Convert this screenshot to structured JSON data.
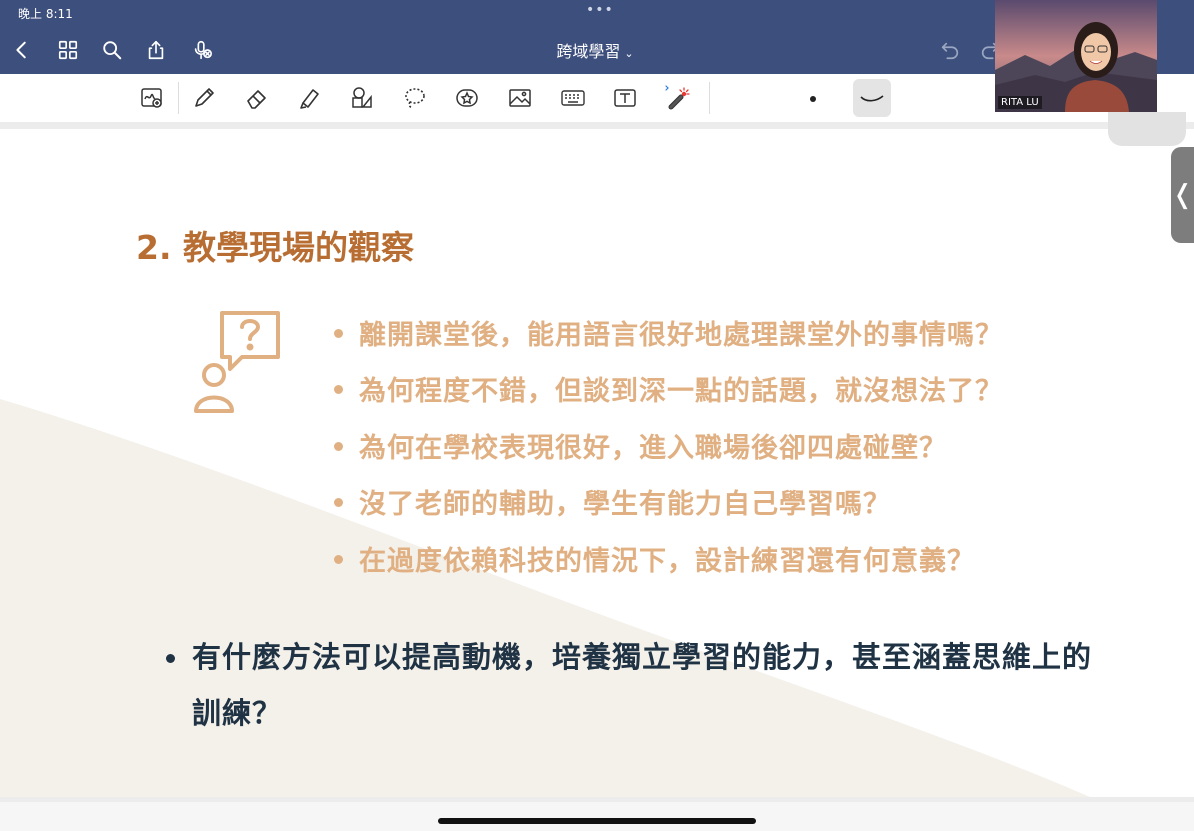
{
  "status_bar": {
    "time": "晚上 8:11",
    "dots": "•••"
  },
  "nav": {
    "title": "跨域學習",
    "title_chevron": "⌄",
    "icons": [
      "back-icon",
      "grid-icon",
      "search-icon",
      "share-icon",
      "mic-off-icon",
      "undo-icon",
      "redo-icon"
    ]
  },
  "toolbar": {
    "tools": [
      "zoom-draw-tool",
      "pen-tool",
      "eraser-tool",
      "highlighter-tool",
      "shapes-tool",
      "lasso-tool",
      "sticker-tool",
      "image-tool",
      "keyboard-tool",
      "text-tool",
      "laser-pointer-tool"
    ],
    "colors": {
      "toolbar_bg": "#ffffff",
      "nav_bg": "#3d4f7c",
      "selected_bg": "#e4e4e4"
    }
  },
  "slide": {
    "title": "2. 教學現場的觀察",
    "questions": [
      "離開課堂後，能用語言很好地處理課堂外的事情嗎？",
      "為何程度不錯，但談到深一點的話題，就沒想法了？",
      "為何在學校表現很好，進入職場後卻四處碰壁？",
      "沒了老師的輔助，學生有能力自己學習嗎？",
      "在過度依賴科技的情況下，設計練習還有何意義？"
    ],
    "main_question": "有什麼方法可以提高動機，培養獨立學習的能力，甚至涵蓋思維上的訓練？",
    "colors": {
      "title": "#b86e32",
      "question": "#e0b083",
      "main": "#1f3344"
    }
  },
  "video": {
    "participant": "RITA LU"
  },
  "side_handle": {
    "glyph": "❬"
  }
}
